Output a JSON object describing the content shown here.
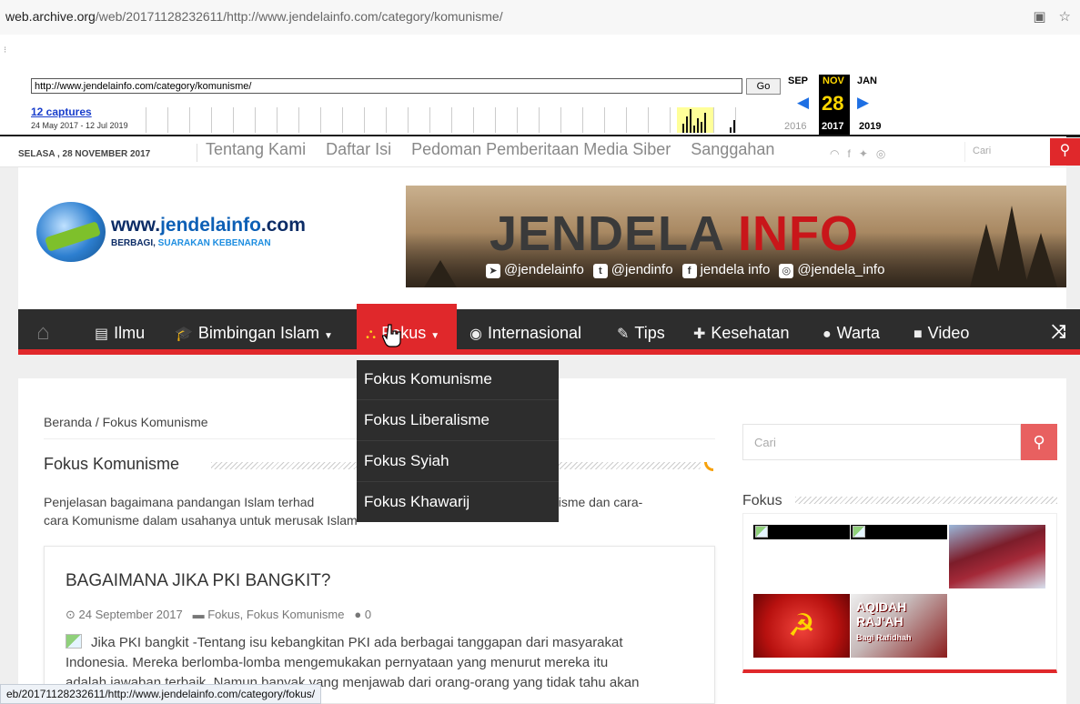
{
  "browser": {
    "url_host": "web.archive.org",
    "url_path": "/web/20171128232611/http://www.jendelainfo.com/category/komunisme/",
    "status_url": "eb/20171128232611/http://www.jendelainfo.com/category/fokus/"
  },
  "wayback": {
    "input_value": "http://www.jendelainfo.com/category/komunisme/",
    "go_label": "Go",
    "captures_label": "12 captures",
    "range_label": "24 May 2017 - 12 Jul 2019",
    "prev_month": "SEP",
    "current_month": "NOV",
    "next_month": "JAN",
    "day": "28",
    "prev_year": "2016",
    "current_year": "2017",
    "next_year": "2019"
  },
  "topbar": {
    "date": "SELASA , 28 NOVEMBER 2017",
    "links": [
      "Tentang Kami",
      "Daftar Isi",
      "Pedoman Pemberitaan Media Siber",
      "Sanggahan"
    ],
    "search_placeholder": "Cari"
  },
  "logo": {
    "title_prefix": "www.",
    "title_main": "jendelainfo",
    "title_suffix": ".com",
    "sub_a": "BERBAGI, ",
    "sub_b": "SUARAKAN KEBENARAN"
  },
  "banner": {
    "title_a": "JENDELA ",
    "title_b": "INFO",
    "telegram": "@jendelainfo",
    "tumblr": "@jendinfo",
    "facebook": "jendela info",
    "instagram": "@jendela_info"
  },
  "nav": {
    "items": [
      "Ilmu",
      "Bimbingan Islam",
      "Fokus",
      "Internasional",
      "Tips",
      "Kesehatan",
      "Warta",
      "Video"
    ],
    "dropdown": [
      "Fokus Komunisme",
      "Fokus Liberalisme",
      "Fokus Syiah",
      "Fokus Khawarij"
    ]
  },
  "page": {
    "breadcrumb_home": "Beranda",
    "breadcrumb_sep": "/",
    "breadcrumb_current": "Fokus Komunisme",
    "category_title": "Fokus Komunisme",
    "category_desc_a": "Penjelasan bagaimana pandangan Islam terhad",
    "category_desc_b": "Komunisme dan cara-",
    "category_desc_c": "cara Komunisme dalam usahanya untuk merusak Islam"
  },
  "post": {
    "title": "BAGAIMANA JIKA PKI BANGKIT?",
    "date": "24 September 2017",
    "categories": "Fokus, Fokus Komunisme",
    "comments": "0",
    "excerpt_1": "Jika PKI bangkit -Tentang isu kebangkitan PKI ada berbagai tanggapan dari masyarakat",
    "excerpt_2": "Indonesia. Mereka berlomba-lomba mengemukakan pernyataan yang menurut mereka itu",
    "excerpt_3": "adalah jawaban terbaik. Namun banyak yang menjawab dari orang-orang yang tidak tahu akan"
  },
  "sidebar": {
    "search_placeholder": "Cari",
    "fokus_title": "Fokus",
    "thumb_aqidah": "AQIDAH RAJ'AH",
    "thumb_aqidah_sub": "Bagi Rafidhah"
  },
  "icons": {
    "home": "home-icon",
    "book": "book-icon",
    "cap": "graduation-cap-icon",
    "binoculars": "binoculars-icon",
    "globe": "globe-icon",
    "wrench": "wrench-icon",
    "medkit": "medkit-icon",
    "comments": "comments-icon",
    "video": "video-camera-icon",
    "shuffle": "shuffle-icon",
    "search": "search-icon",
    "rss": "rss-icon"
  },
  "colors": {
    "accent_red": "#e0282b",
    "nav_dark": "#2d2d2d",
    "wayback_gold": "#ffd700"
  }
}
